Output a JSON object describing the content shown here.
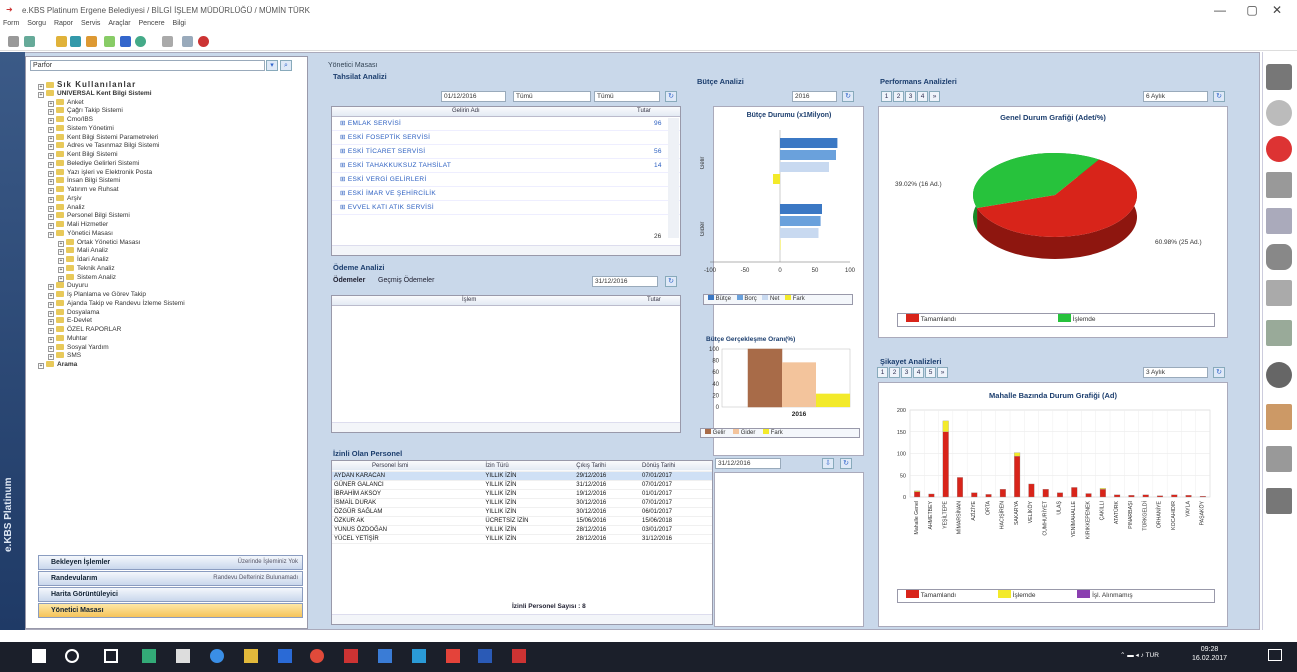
{
  "window": {
    "title": "e.KBS Platinum Ergene Belediyesi / BİLGİ İŞLEM MÜDÜRLÜĞÜ / MÜMİN TÜRK",
    "minimize": "—",
    "maximize": "▢",
    "close": "✕"
  },
  "menu": [
    "Form",
    "Sorgu",
    "Rapor",
    "Servis",
    "Araçlar",
    "Pencere",
    "Bilgi"
  ],
  "sidebar": {
    "filter_value": "Parfor",
    "tree": [
      "Sık Kullanılanlar",
      "UNIVERSAL Kent Bilgi Sistemi",
      "Anket",
      "Çağrı Takip Sistemi",
      "Cmo/IBS",
      "Sistem Yönetimi",
      "Kent Bilgi Sistemi Parametreleri",
      "Adres ve Tasınmaz Bilgi Sistemi",
      "Kent Bilgi Sistemi",
      "Belediye Gelirleri Sistemi",
      "Yazı işleri ve Elektronik Posta",
      "İnsan Bilgi Sistemi",
      "Yatırım ve Ruhsat",
      "Arşiv",
      "Analiz",
      "Personel Bilgi Sistemi",
      "Mali Hizmetler",
      "Yönetici Masası",
      "Ortak Yönetici Masası",
      "Mali Analiz",
      "İdari Analiz",
      "Teknik Analiz",
      "Sistem Analiz",
      "Duyuru",
      "İş Planlama ve Görev Takip",
      "Ajanda Takip ve Randevu İzleme Sistemi",
      "Dosyalama",
      "E-Devlet",
      "ÖZEL RAPORLAR",
      "Muhtar",
      "Sosyal Yardım",
      "SMS",
      "Arama"
    ],
    "accordion": [
      {
        "label": "Bekleyen İşlemler",
        "hint": "Üzerinde İşleminiz Yok"
      },
      {
        "label": "Randevularım",
        "hint": "Randevu Defteriniz Bulunamadı"
      },
      {
        "label": "Harita Görüntüleyici",
        "hint": ""
      },
      {
        "label": "Yönetici Masası",
        "hint": ""
      }
    ],
    "brand": "e.KBS Platinum"
  },
  "dashboard": {
    "header": "Yönetici Masası",
    "tahsilat": {
      "title": "Tahsilat Analizi",
      "date": "01/12/2016",
      "period": "Tümü",
      "type": "Tümü",
      "col_name": "Gelirin Adı",
      "col_amount": "Tutar",
      "rows": [
        "EMLAK SERVİSİ",
        "ESKİ FOSEPTİK SERVİSİ",
        "ESKİ TİCARET SERVİSİ",
        "ESKİ TAHAKKUKSUZ TAHSİLAT",
        "ESKİ VERGİ GELİRLERİ",
        "ESKİ İMAR VE ŞEHİRCİLİK",
        "EVVEL KATI ATIK SERVİSİ"
      ],
      "amounts": [
        "96",
        "",
        "56",
        "14",
        "",
        "",
        ""
      ],
      "total": "26"
    },
    "odeme": {
      "title": "Ödeme Analizi",
      "tab1": "Ödemeler",
      "tab2": "Geçmiş Ödemeler",
      "date": "31/12/2016",
      "col_name": "İşlem",
      "col_amount": "Tutar"
    },
    "izinli": {
      "title": "İzinli Olan Personel",
      "date": "31/12/2016",
      "cols": [
        "Personel İsmi",
        "İzin Türü",
        "Çıkış Tarihi",
        "Dönüş Tarihi"
      ],
      "rows": [
        [
          "AYDAN KARACAN",
          "YILLIK İZİN",
          "29/12/2016",
          "07/01/2017"
        ],
        [
          "GÜNER GALANCI",
          "YILLIK İZİN",
          "31/12/2016",
          "07/01/2017"
        ],
        [
          "İBRAHİM AKSOY",
          "YILLIK İZİN",
          "19/12/2016",
          "01/01/2017"
        ],
        [
          "İSMAİL DURAK",
          "YILLIK İZİN",
          "30/12/2016",
          "07/01/2017"
        ],
        [
          "ÖZGÜR SAĞLAM",
          "YILLIK İZİN",
          "30/12/2016",
          "06/01/2017"
        ],
        [
          "ÖZKUR AK",
          "ÜCRETSİZ İZİN",
          "15/06/2016",
          "15/06/2018"
        ],
        [
          "YUNUS ÖZDOĞAN",
          "YILLIK İZİN",
          "28/12/2016",
          "03/01/2017"
        ],
        [
          "YÜCEL YETİŞİR",
          "YILLIK İZİN",
          "28/12/2016",
          "31/12/2016"
        ]
      ],
      "footer": "İzinli Personel Sayısı : 8"
    },
    "butce": {
      "title": "Bütçe Analizi",
      "year": "2016",
      "chart_title": "Bütçe Durumu (x1Milyon)",
      "legend": [
        "Bütçe",
        "Borç",
        "Net",
        "Fark"
      ]
    },
    "gerceklesme": {
      "title": "Bütçe Gerçekleşme Oranı(%)",
      "legend": [
        "Gelir",
        "Gider",
        "Fark"
      ],
      "year": "2016"
    },
    "performans": {
      "title": "Performans Analizleri",
      "pages": [
        "1",
        "2",
        "3",
        "4"
      ],
      "period": "6 Aylık",
      "chart_title": "Genel Durum Grafiği (Adet/%)",
      "legend": [
        "Tamamlandı",
        "İşlemde"
      ]
    },
    "sikayet": {
      "title": "Şikayet Analizleri",
      "pages": [
        "1",
        "2",
        "3",
        "4",
        "5"
      ],
      "period": "3 Aylık",
      "chart_title": "Mahalle Bazında Durum Grafiği (Ad)",
      "legend": [
        "Tamamlandı",
        "İşlemde",
        "İşl. Alınmamış"
      ]
    }
  },
  "chart_data": [
    {
      "type": "bar",
      "title": "Bütçe Durumu (x1Milyon)",
      "categories": [
        "Gelir",
        "Gider"
      ],
      "series": [
        {
          "name": "Bütçe",
          "values": [
            82,
            60
          ]
        },
        {
          "name": "Borç",
          "values": [
            80,
            58
          ]
        },
        {
          "name": "Net",
          "values": [
            70,
            55
          ]
        },
        {
          "name": "Fark",
          "values": [
            -10,
            0
          ]
        }
      ],
      "xlim": [
        -100,
        100
      ],
      "x_ticks": [
        "-100",
        "-50",
        "0",
        "50",
        "100"
      ]
    },
    {
      "type": "bar",
      "title": "Bütçe Gerçekleşme Oranı(%)",
      "categories": [
        "2016"
      ],
      "series": [
        {
          "name": "Gelir",
          "values": [
            100
          ]
        },
        {
          "name": "Gider",
          "values": [
            77
          ]
        },
        {
          "name": "Fark",
          "values": [
            23
          ]
        }
      ],
      "ylim": [
        0,
        100
      ],
      "y_ticks": [
        "0",
        "20",
        "40",
        "60",
        "80",
        "100"
      ]
    },
    {
      "type": "pie",
      "title": "Genel Durum Grafiği (Adet/%)",
      "slices": [
        {
          "label": "Tamamlandı",
          "value": 25,
          "pct": "60.98%",
          "text": "60.98% (25 Ad.)"
        },
        {
          "label": "İşlemde",
          "value": 16,
          "pct": "39.02%",
          "text": "39.02% (16 Ad.)"
        }
      ]
    },
    {
      "type": "bar",
      "title": "Mahalle Bazında Durum Grafiği (Ad)",
      "ylim": [
        0,
        200
      ],
      "y_ticks": [
        "0",
        "50",
        "100",
        "150",
        "200"
      ],
      "categories": [
        "Mahalle Genel",
        "AHMETBEY",
        "YEŞİLTEPE",
        "MİMARSİNAN",
        "AZİZİYE",
        "ORTA",
        "HACIŞİREN",
        "SAKARYA",
        "VELİKÖY",
        "CUMHURİYET",
        "ULAŞ",
        "YENİMAHALLE",
        "KIRIKKEPENEK",
        "ÇAKILLI",
        "ATATÜRK",
        "PINARBAŞI",
        "TÜRKGELDİ",
        "ORHANİYE",
        "KOCAHIDIR",
        "YAYLA",
        "PAŞAKÖY"
      ],
      "series": [
        {
          "name": "Tamamlandı",
          "values": [
            12,
            7,
            150,
            45,
            10,
            6,
            18,
            94,
            30,
            18,
            10,
            22,
            8,
            18,
            5,
            4,
            5,
            3,
            5,
            4,
            2
          ]
        },
        {
          "name": "İşlemde",
          "values": [
            2,
            0,
            25,
            0,
            0,
            0,
            0,
            8,
            0,
            0,
            0,
            0,
            0,
            2,
            0,
            0,
            0,
            0,
            0,
            0,
            0
          ]
        },
        {
          "name": "İşl. Alınmamış",
          "values": [
            0,
            0,
            0,
            0,
            0,
            0,
            0,
            0,
            0,
            0,
            0,
            0,
            0,
            0,
            0,
            0,
            0,
            0,
            0,
            0,
            0
          ]
        }
      ]
    }
  ],
  "taskbar": {
    "lang": "TUR",
    "time": "09:28",
    "date": "16.02.2017"
  },
  "colors": {
    "frame": "#c9d8ea",
    "title_blue": "#1c3e6e",
    "red": "#d8241a",
    "green": "#27c23c",
    "yellow": "#f3ea2a"
  }
}
